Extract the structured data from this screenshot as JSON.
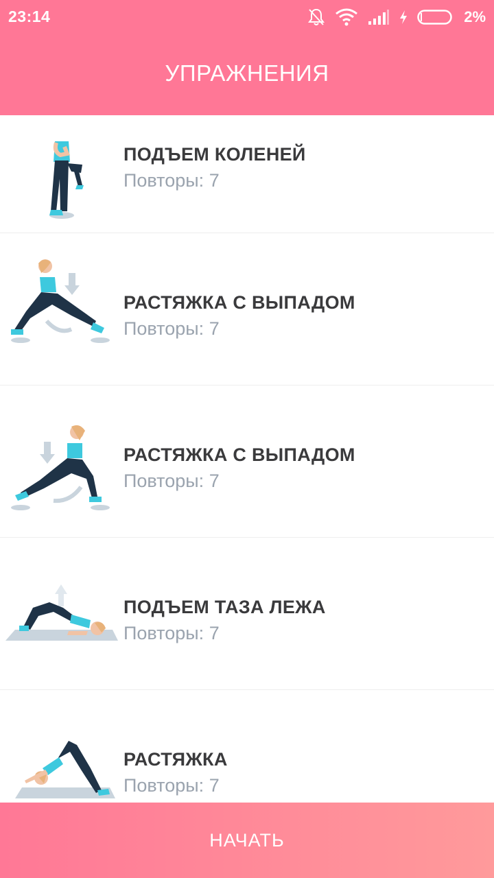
{
  "status_bar": {
    "time": "23:14",
    "battery_percent": "2%",
    "icons": [
      "mute-bell-icon",
      "wifi-icon",
      "signal-icon",
      "charging-icon",
      "battery-icon"
    ]
  },
  "header": {
    "title": "УПРАЖНЕНИЯ"
  },
  "exercises": [
    {
      "name": "ПОДЪЕМ КОЛЕНЕЙ",
      "reps_label": "Повторы:",
      "reps": "7",
      "illustration": "knee-raise-illustration"
    },
    {
      "name": "РАСТЯЖКА С ВЫПАДОМ",
      "reps_label": "Повторы:",
      "reps": "7",
      "illustration": "lunge-stretch-right-illustration"
    },
    {
      "name": "РАСТЯЖКА С ВЫПАДОМ",
      "reps_label": "Повторы:",
      "reps": "7",
      "illustration": "lunge-stretch-left-illustration"
    },
    {
      "name": "ПОДЪЕМ ТАЗА ЛЕЖА",
      "reps_label": "Повторы:",
      "reps": "7",
      "illustration": "glute-bridge-illustration"
    },
    {
      "name": "РАСТЯЖКА",
      "reps_label": "Повторы:",
      "reps": "7",
      "illustration": "downward-dog-illustration"
    }
  ],
  "footer": {
    "start_label": "НАЧАТЬ"
  },
  "colors": {
    "header": "#ff7796",
    "button_start": "#ff7896",
    "button_end": "#ff9a9b",
    "title_text": "#3a3a3c",
    "subtitle_text": "#9aa3ae",
    "accent_top": "#3ec9de",
    "pants": "#1f3347"
  }
}
